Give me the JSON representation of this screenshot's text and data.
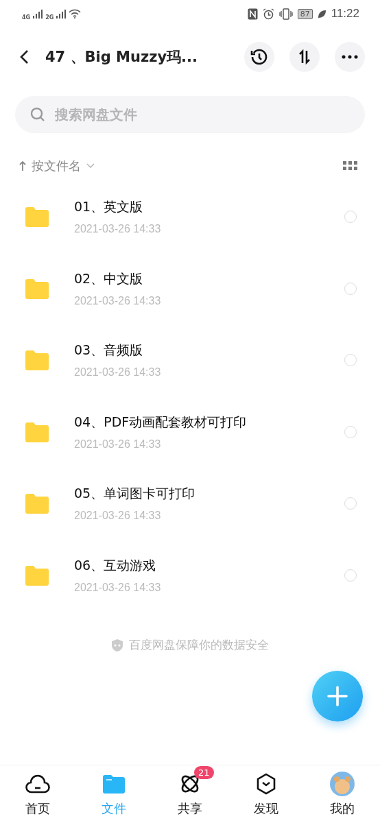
{
  "status_bar": {
    "signal_1": "4G",
    "signal_2": "2G",
    "battery": "87",
    "time": "11:22"
  },
  "header": {
    "title": "47 、Big Muzzy玛..."
  },
  "search": {
    "placeholder": "搜索网盘文件"
  },
  "sort": {
    "label": "按文件名"
  },
  "files": [
    {
      "name": "01、英文版",
      "date": "2021-03-26  14:33",
      "selected": false
    },
    {
      "name": "02、中文版",
      "date": "2021-03-26  14:33",
      "selected": false
    },
    {
      "name": "03、音频版",
      "date": "2021-03-26  14:33",
      "selected": false
    },
    {
      "name": "04、PDF动画配套教材可打印",
      "date": "2021-03-26  14:33",
      "selected": false
    },
    {
      "name": "05、单词图卡可打印",
      "date": "2021-03-26  14:33",
      "selected": false
    },
    {
      "name": "06、互动游戏",
      "date": "2021-03-26  14:33",
      "selected": false
    }
  ],
  "footer_note": "百度网盘保障你的数据安全",
  "tabs": [
    {
      "label": "首页",
      "kind": "home",
      "selected": false
    },
    {
      "label": "文件",
      "kind": "files",
      "selected": true
    },
    {
      "label": "共享",
      "kind": "share",
      "selected": false,
      "badge": "21"
    },
    {
      "label": "发现",
      "kind": "discover",
      "selected": false
    },
    {
      "label": "我的",
      "kind": "me",
      "selected": false
    }
  ]
}
